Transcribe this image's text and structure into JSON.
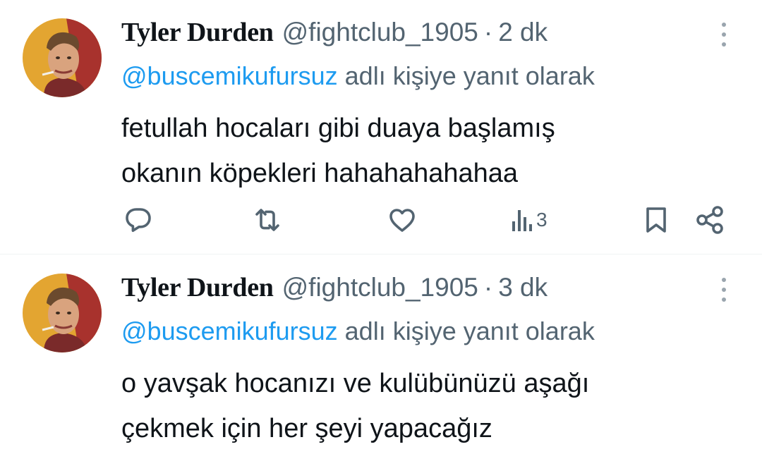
{
  "tweets": [
    {
      "name": "Tyler Durden",
      "handle": "@fightclub_1905",
      "separator": "·",
      "time": "2 dk",
      "reply_to_mention": "@buscemikufursuz",
      "reply_suffix": " adlı kişiye yanıt olarak",
      "text": "fetullah hocaları gibi duaya başlamış\nokanın köpekleri hahahahahahaa",
      "views": "3",
      "icons": [
        "reply-icon",
        "retweet-icon",
        "like-icon",
        "views-icon",
        "bookmark-icon",
        "share-icon",
        "more-icon"
      ]
    },
    {
      "name": "Tyler Durden",
      "handle": "@fightclub_1905",
      "separator": "·",
      "time": "3 dk",
      "reply_to_mention": "@buscemikufursuz",
      "reply_suffix": " adlı kişiye yanıt olarak",
      "text": "o yavşak hocanızı ve kulübünüzü aşağı\nçekmek için her şeyi yapacağız",
      "icons": [
        "more-icon"
      ]
    }
  ],
  "colors": {
    "accent": "#1d9bf0",
    "secondary_text": "#536471",
    "primary_text": "#0f1419",
    "divider": "#eff3f4"
  }
}
